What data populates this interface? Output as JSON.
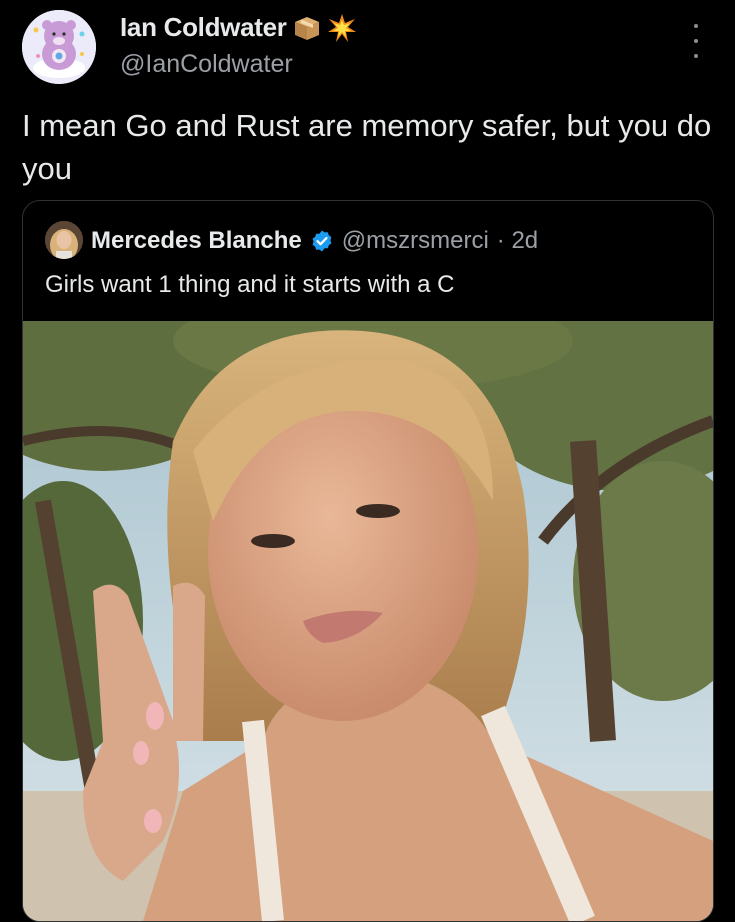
{
  "author": {
    "name": "Ian Coldwater",
    "handle": "@IanColdwater",
    "name_emoji": [
      "package-icon",
      "collision-icon"
    ]
  },
  "tweet": {
    "text": "I mean Go and Rust are memory safer, but you do you"
  },
  "quoted": {
    "name": "Mercedes Blanche",
    "handle": "@mszrsmerci",
    "time": "· 2d",
    "text": "Girls want 1 thing and it starts with a C",
    "verified": true,
    "verified_color": "#1d9bf0"
  },
  "colors": {
    "background": "#000000",
    "text": "#e7e9ea",
    "muted": "#9aa0a6",
    "border": "#2f3336"
  }
}
